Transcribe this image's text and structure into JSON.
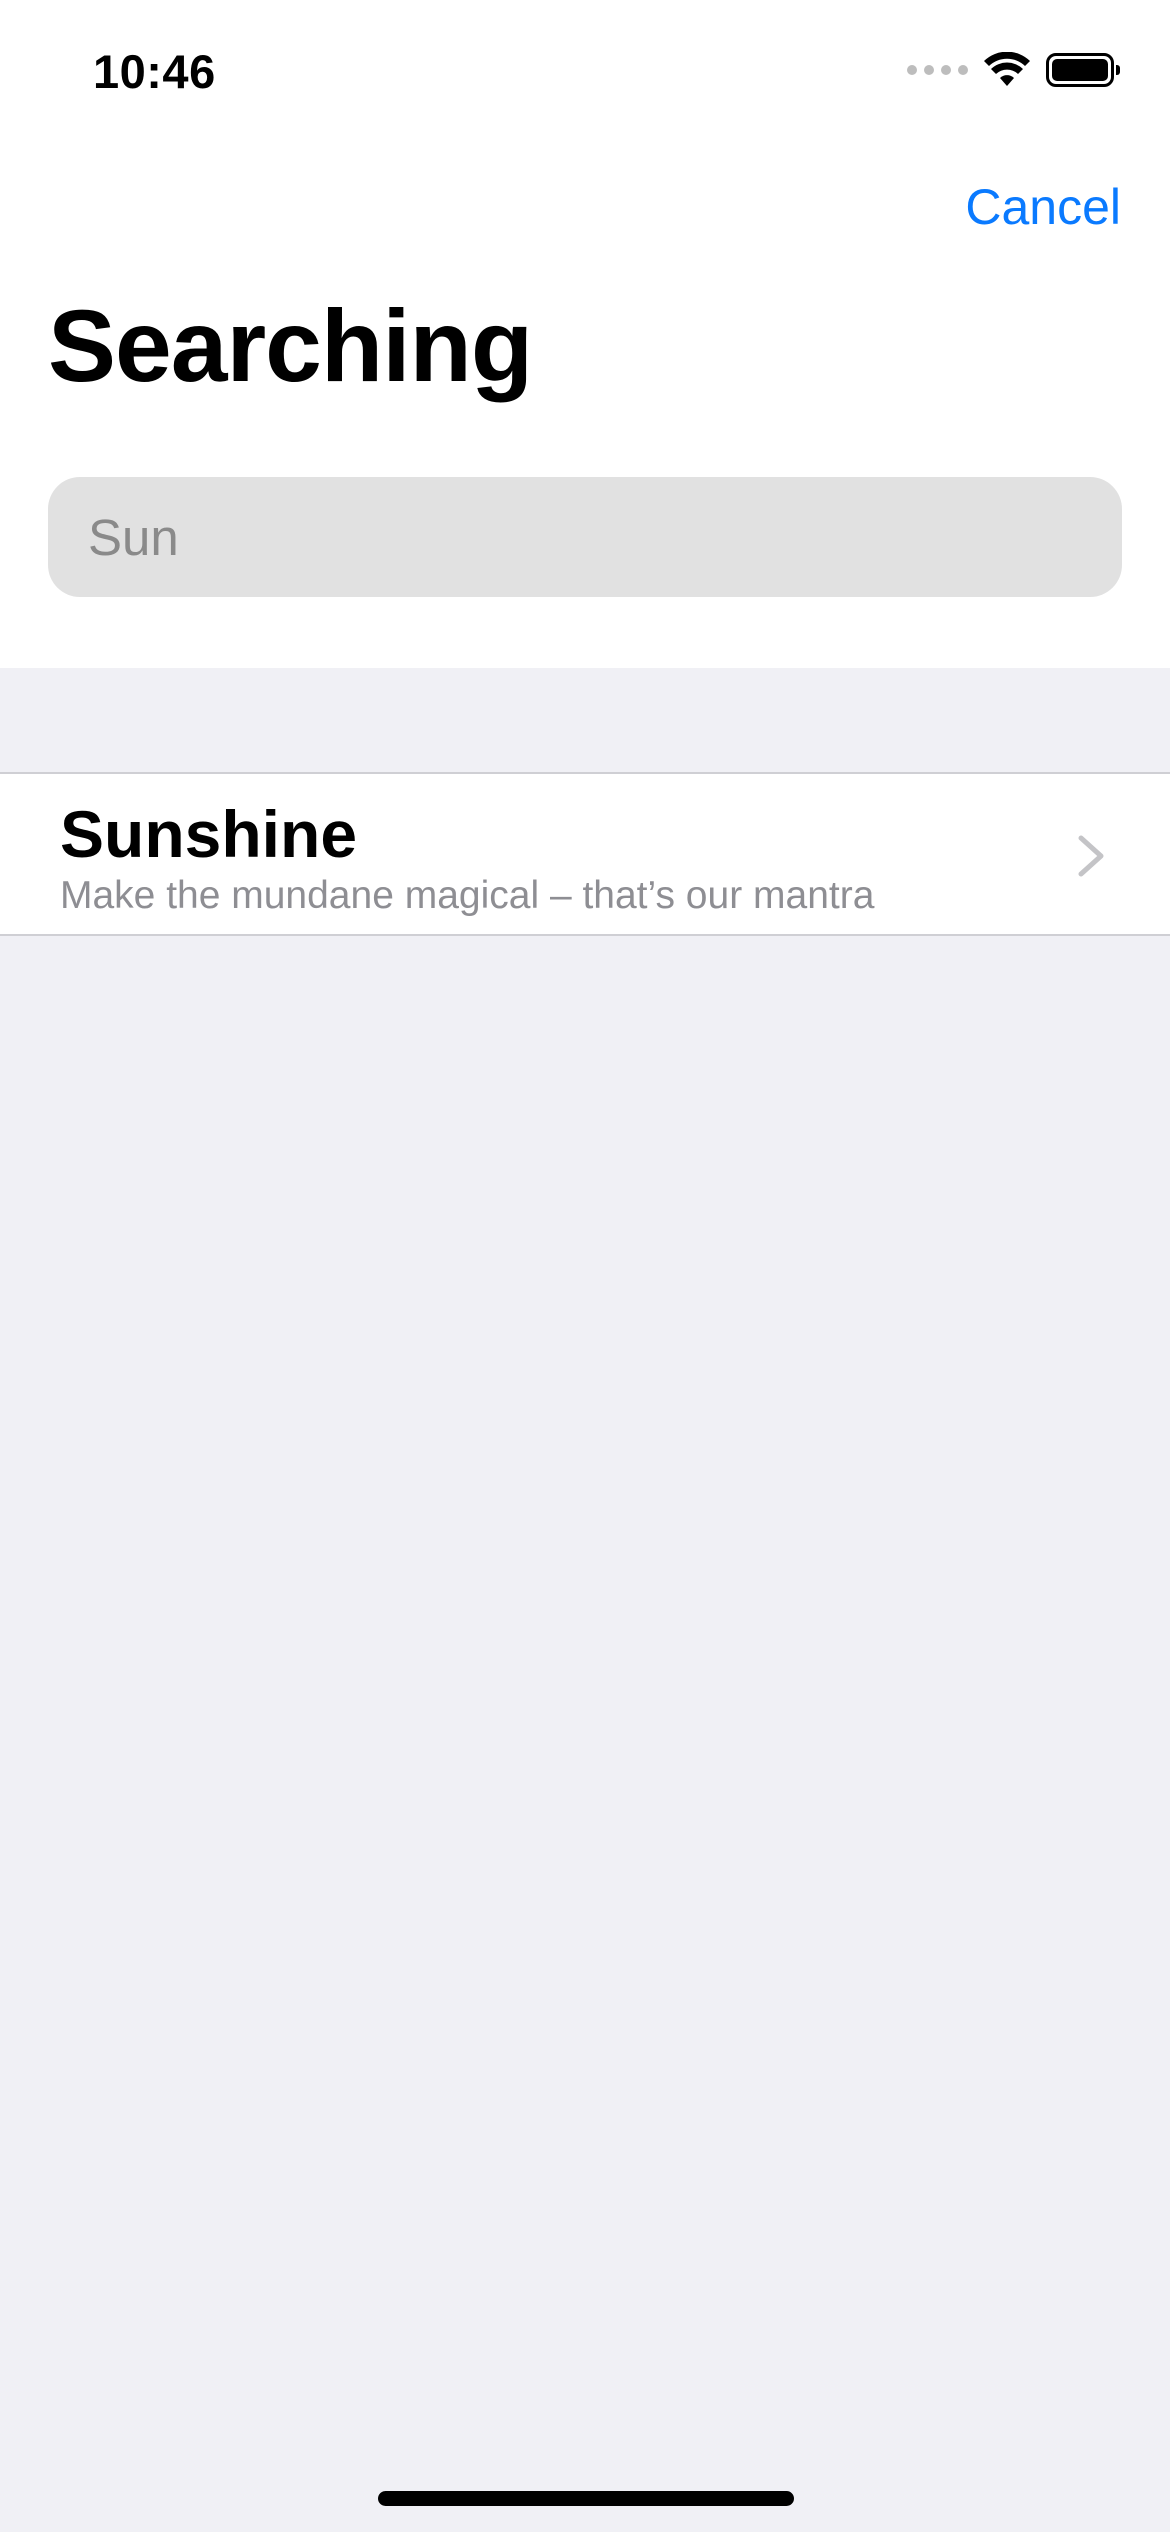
{
  "status_bar": {
    "time": "10:46",
    "signal_icon": "signal-dots-icon",
    "wifi_icon": "wifi-icon",
    "battery_icon": "battery-icon"
  },
  "nav": {
    "cancel_label": "Cancel"
  },
  "page": {
    "title": "Searching"
  },
  "search": {
    "value": "Sun",
    "placeholder": "Sun"
  },
  "results": [
    {
      "title": "Sunshine",
      "subtitle": "Make the mundane magical – that’s our mantra",
      "accessory_icon": "chevron-right-icon"
    }
  ],
  "colors": {
    "accent": "#0A7AFF",
    "background": "#F0F0F5",
    "search_field": "#E1E1E1",
    "secondary_text": "#8E8E93"
  }
}
